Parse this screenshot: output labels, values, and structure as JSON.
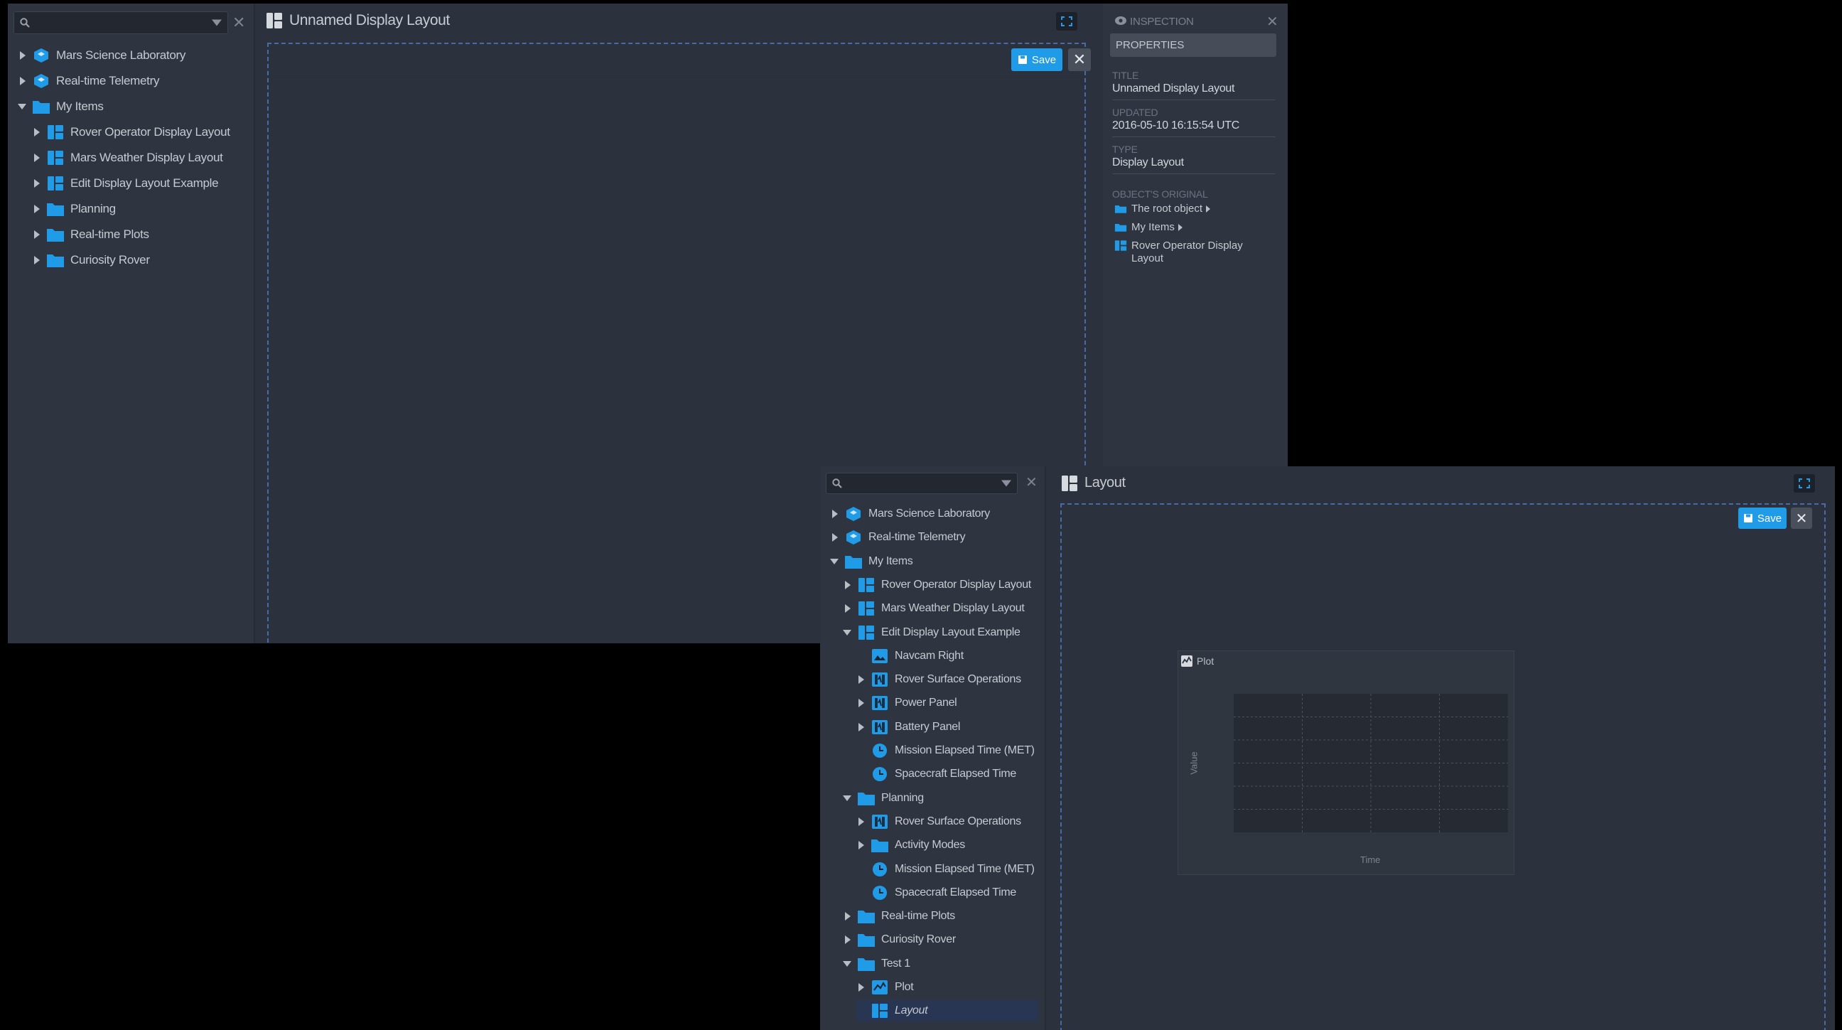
{
  "window1": {
    "search": {
      "placeholder": ""
    },
    "tree": [
      {
        "label": "Mars Science Laboratory",
        "icon": "hexagon-icon",
        "expanded": false
      },
      {
        "label": "Real-time Telemetry",
        "icon": "hexagon-icon",
        "expanded": false
      },
      {
        "label": "My Items",
        "icon": "folder-icon",
        "expanded": true
      },
      {
        "label": "Rover Operator Display Layout",
        "icon": "layout-icon",
        "expanded": false
      },
      {
        "label": "Mars Weather Display Layout",
        "icon": "layout-icon",
        "expanded": false
      },
      {
        "label": "Edit Display Layout Example",
        "icon": "layout-icon",
        "expanded": false
      },
      {
        "label": "Planning",
        "icon": "folder-icon",
        "expanded": false
      },
      {
        "label": "Real-time Plots",
        "icon": "folder-icon",
        "expanded": false
      },
      {
        "label": "Curiosity Rover",
        "icon": "folder-icon",
        "expanded": false
      }
    ],
    "title": "Unnamed Display Layout",
    "save_label": "Save",
    "inspection": {
      "header": "INSPECTION",
      "tab": "PROPERTIES",
      "title_label": "TITLE",
      "title_value": "Unnamed Display Layout",
      "updated_label": "UPDATED",
      "updated_value": "2016-05-10 16:15:54 UTC",
      "type_label": "TYPE",
      "type_value": "Display Layout",
      "original_label": "OBJECT'S ORIGINAL",
      "original_path": [
        "The root object",
        "My Items",
        "Rover Operator Display Layout"
      ]
    }
  },
  "window2": {
    "search": {
      "placeholder": ""
    },
    "tree": [
      {
        "label": "Mars Science Laboratory",
        "icon": "hexagon-icon",
        "expanded": false
      },
      {
        "label": "Real-time Telemetry",
        "icon": "hexagon-icon",
        "expanded": false
      },
      {
        "label": "My Items",
        "icon": "folder-icon",
        "expanded": true
      },
      {
        "label": "Rover Operator Display Layout",
        "icon": "layout-icon",
        "expanded": false
      },
      {
        "label": "Mars Weather Display Layout",
        "icon": "layout-icon",
        "expanded": false
      },
      {
        "label": "Edit Display Layout Example",
        "icon": "layout-icon",
        "expanded": true
      },
      {
        "label": "Navcam Right",
        "icon": "image-icon",
        "expanded": null
      },
      {
        "label": "Rover Surface Operations",
        "icon": "telemetry-icon",
        "expanded": false
      },
      {
        "label": "Power Panel",
        "icon": "telemetry-icon",
        "expanded": false
      },
      {
        "label": "Battery Panel",
        "icon": "telemetry-icon",
        "expanded": false
      },
      {
        "label": "Mission Elapsed Time (MET)",
        "icon": "clock-icon",
        "expanded": null
      },
      {
        "label": "Spacecraft Elapsed Time",
        "icon": "clock-icon",
        "expanded": null
      },
      {
        "label": "Planning",
        "icon": "folder-icon",
        "expanded": true
      },
      {
        "label": "Rover Surface Operations",
        "icon": "telemetry-icon",
        "expanded": false
      },
      {
        "label": "Activity Modes",
        "icon": "folder-icon",
        "expanded": false
      },
      {
        "label": "Mission Elapsed Time (MET)",
        "icon": "clock-icon",
        "expanded": null
      },
      {
        "label": "Spacecraft Elapsed Time",
        "icon": "clock-icon",
        "expanded": null
      },
      {
        "label": "Real-time Plots",
        "icon": "folder-icon",
        "expanded": false
      },
      {
        "label": "Curiosity Rover",
        "icon": "folder-icon",
        "expanded": false
      },
      {
        "label": "Test 1",
        "icon": "folder-icon",
        "expanded": true
      },
      {
        "label": "Plot",
        "icon": "plot-icon",
        "expanded": false
      },
      {
        "label": "Layout",
        "icon": "layout-icon",
        "expanded": null,
        "selected": true
      }
    ],
    "title": "Layout",
    "save_label": "Save",
    "plot": {
      "title": "Plot",
      "ylabel": "Value",
      "xlabel": "Time"
    }
  },
  "colors": {
    "accent": "#1f9be8",
    "folder": "#1f9be8",
    "selection": "#283553",
    "panel": "#2e3440",
    "canvas": "#2c323d"
  }
}
